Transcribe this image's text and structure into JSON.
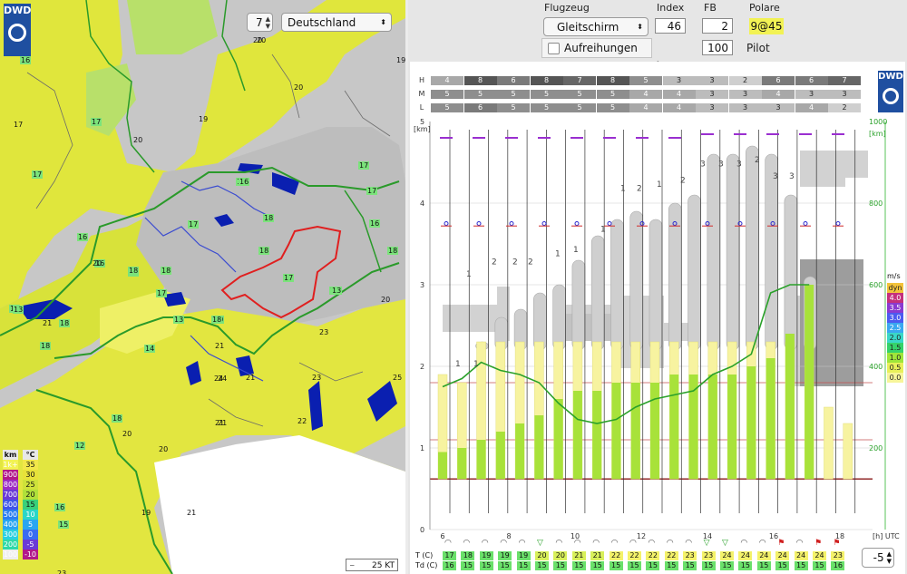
{
  "map": {
    "logo": "DWD",
    "zoom_value": "7",
    "region_select": "Deutschland",
    "scale_label": "25 KT",
    "legend": {
      "km_header": "km",
      "c_header": "°C",
      "km": [
        "1k+",
        "900",
        "800",
        "700",
        "600",
        "500",
        "400",
        "300",
        "200",
        "100"
      ],
      "c": [
        "35",
        "30",
        "25",
        "20",
        "15",
        "10",
        "5",
        "0",
        "-5",
        "-10"
      ]
    },
    "labels_green": [
      "16",
      "17",
      "17",
      "17",
      "18",
      "18",
      "16",
      "17",
      "17",
      "18",
      "18",
      "17",
      "18",
      "13",
      "13",
      "20",
      "18",
      "16",
      "17",
      "18",
      "16",
      "18",
      "13",
      "17",
      "13",
      "16",
      "18",
      "14",
      "17",
      "15",
      "12",
      "18",
      "16"
    ],
    "labels_plain": [
      "20",
      "20",
      "19",
      "20",
      "17",
      "20",
      "19",
      "20",
      "21",
      "21",
      "20",
      "24",
      "21",
      "23",
      "22",
      "21",
      "20",
      "24",
      "23",
      "25",
      "21",
      "21",
      "19",
      "23",
      "20"
    ]
  },
  "controls": {
    "flugzeug_label": "Flugzeug",
    "flugzeug_value": "Gleitschirm",
    "index_label": "Index",
    "index_value": "46",
    "fb_label": "FB",
    "fb_value": "2",
    "polare_label": "Polare",
    "polare_value": "9@45",
    "aufreihungen_label": "Aufreihungen",
    "pilot_value": "100",
    "pilot_label": "Pilot"
  },
  "meteogram": {
    "logo": "DWD",
    "cloud_rows": [
      {
        "level": "H",
        "values": [
          "4",
          "8",
          "6",
          "8",
          "7",
          "8",
          "5",
          "3",
          "3",
          "2",
          "6",
          "6",
          "7"
        ]
      },
      {
        "level": "M",
        "values": [
          "5",
          "5",
          "5",
          "5",
          "5",
          "5",
          "4",
          "4",
          "3",
          "3",
          "4",
          "3",
          "3"
        ]
      },
      {
        "level": "L",
        "values": [
          "5",
          "6",
          "5",
          "5",
          "5",
          "5",
          "4",
          "4",
          "3",
          "3",
          "3",
          "4",
          "2"
        ]
      }
    ],
    "y_left_unit": "[km]",
    "y_left_ticks": [
      "5",
      "4",
      "3",
      "2",
      "1",
      "0"
    ],
    "y_right_unit": "[km]",
    "y_right_ticks": [
      "1000",
      "800",
      "600",
      "400",
      "200"
    ],
    "x_ticks": [
      "6",
      "8",
      "10",
      "12",
      "14",
      "16",
      "18"
    ],
    "x_unit": "[h] UTC",
    "cloud_numbers": [
      "1",
      "1",
      "1",
      "2",
      "2",
      "2",
      "1",
      "1",
      "1",
      "1",
      "2",
      "1",
      "2",
      "3",
      "3",
      "3",
      "2",
      "3",
      "3"
    ],
    "ms_legend": {
      "unit": "m/s",
      "labels": [
        "dyn",
        "4.0",
        "3.5",
        "3.0",
        "2.5",
        "2.0",
        "1.5",
        "1.0",
        "0.5",
        "0.0"
      ],
      "colors": [
        "#f3c33a",
        "#c4307c",
        "#8a3ad0",
        "#4c5bf0",
        "#3aa8f0",
        "#3ad8c8",
        "#35d36a",
        "#9fe63a",
        "#e8f05a",
        "#f7f59a"
      ]
    },
    "t_label": "T  (C)",
    "td_label": "Td (C)",
    "t_values": [
      "17",
      "18",
      "19",
      "19",
      "19",
      "20",
      "20",
      "21",
      "21",
      "22",
      "22",
      "22",
      "22",
      "23",
      "23",
      "24",
      "24",
      "24",
      "24",
      "24",
      "24",
      "23"
    ],
    "td_values": [
      "16",
      "15",
      "15",
      "15",
      "15",
      "15",
      "15",
      "15",
      "15",
      "15",
      "15",
      "15",
      "15",
      "15",
      "15",
      "15",
      "15",
      "15",
      "15",
      "15",
      "15",
      "16"
    ],
    "stepper_value": "-5"
  }
}
